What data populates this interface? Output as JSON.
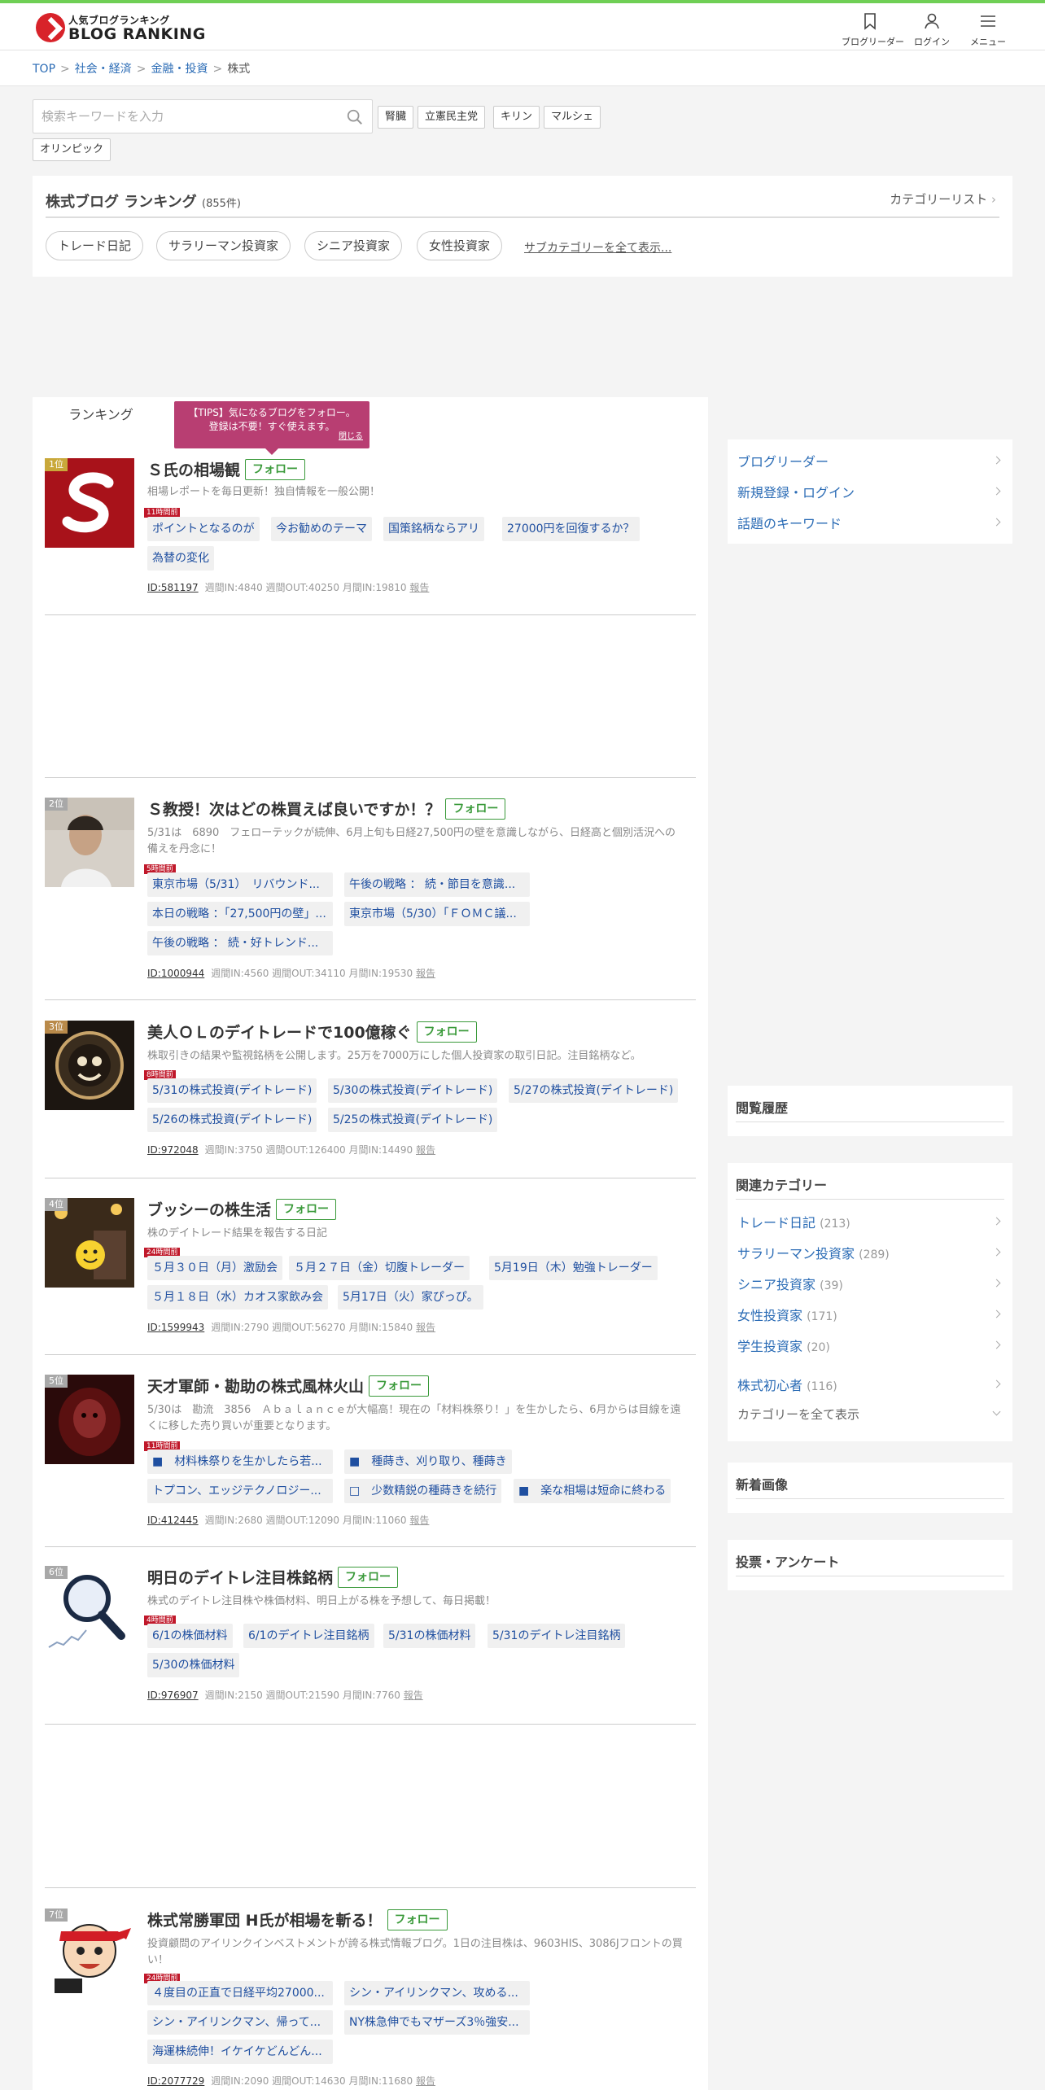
{
  "header": {
    "logo_small": "人気ブログランキング",
    "logo_big": "BLOG RANKING",
    "nav": [
      "ブログリーダー",
      "ログイン",
      "メニュー"
    ]
  },
  "breadcrumb": {
    "items": [
      "TOP",
      "社会・経済",
      "金融・投資"
    ],
    "current": "株式"
  },
  "search": {
    "placeholder": "検索キーワードを入力"
  },
  "keywords": [
    "腎臓",
    "立憲民主党",
    "キリン",
    "マルシェ",
    "オリンピック"
  ],
  "category": {
    "title": "株式ブログ ランキング",
    "count": "(855件)",
    "list_link": "カテゴリーリスト",
    "subcategories": [
      "トレード日記",
      "サラリーマン投資家",
      "シニア投資家",
      "女性投資家"
    ],
    "show_all": "サブカテゴリーを全て表示..."
  },
  "tab": {
    "label": "ランキング"
  },
  "tooltip": {
    "line1": "【TIPS】気になるブログをフォロー。",
    "line2": "登録は不要！すぐ使えます。",
    "close": "閉じる"
  },
  "follow_label": "フォロー",
  "report_label": "報告",
  "entries": [
    {
      "rank": "1位",
      "title": "Ｓ氏の相場観",
      "desc": "相場レポートを毎日更新！独自情報を一般公開！",
      "ago": "11時間前",
      "tags": [
        "ポイントとなるのが",
        "今お勧めのテーマ",
        "国策銘柄ならアリ",
        "27000円を回復するか？",
        "為替の変化"
      ],
      "id": "ID:581197",
      "stats": "週間IN:4840 週間OUT:40250 月間IN:19810"
    },
    {
      "rank": "2位",
      "title": "Ｓ教授！次はどの株買えば良いですか！？",
      "desc": "5/31は　6890　フェローテックが続伸、6月上旬も日経27,500円の壁を意識しながら、日経高と個別活況への備えを丹念に！",
      "ago": "5時間前",
      "tags": [
        "東京市場（5/31）　リバウンド...",
        "午後の戦略 ： 続・節目を意識...",
        "本日の戦略 ：「27,500円の壁」...",
        "東京市場（5/30）「ＦＯＭＣ議...",
        "午後の戦略 ： 続・好トレンド..."
      ],
      "id": "ID:1000944",
      "stats": "週間IN:4560 週間OUT:34110 月間IN:19530"
    },
    {
      "rank": "3位",
      "title": "美人ＯＬのデイトレードで100億稼ぐ",
      "desc": "株取引きの結果や監視銘柄を公開します。25万を7000万にした個人投資家の取引日記。注目銘柄など。",
      "ago": "8時間前",
      "tags": [
        "5/31の株式投資(デイトレード)",
        "5/30の株式投資(デイトレード)",
        "5/27の株式投資(デイトレード)",
        "5/26の株式投資(デイトレード)",
        "5/25の株式投資(デイトレード)"
      ],
      "id": "ID:972048",
      "stats": "週間IN:3750 週間OUT:126400 月間IN:14490"
    },
    {
      "rank": "4位",
      "title": "ブッシーの株生活",
      "desc": "株のデイトレード結果を報告する日記",
      "ago": "24時間前",
      "tags": [
        "５月３０日（月）激励会",
        "５月２７日（金）切腹トレーダー",
        "5月19日（木）勉強トレーダー",
        "５月１８日（水）カオス家飲み会",
        "5月17日（火）家ぴっぴ。"
      ],
      "id": "ID:1599943",
      "stats": "週間IN:2790 週間OUT:56270 月間IN:15840"
    },
    {
      "rank": "5位",
      "title": "天才軍師・勘助の株式風林火山",
      "desc": "5/30は　勘流　3856　Ａｂａｌａｎｃｅが大幅高！現在の「材料株祭り！」を生かしたら、6月からは目線を遠くに移した売り買いが重要となります。",
      "ago": "11時間前",
      "tags": [
        "■　材料株祭りを生かしたら若...",
        "■　種蒔き、刈り取り、種蒔き",
        "トプコン、エッジテクノロジー...",
        "□　少数精鋭の種蒔きを続行",
        "■　楽な相場は短命に終わる"
      ],
      "id": "ID:412445",
      "stats": "週間IN:2680 週間OUT:12090 月間IN:11060"
    },
    {
      "rank": "6位",
      "title": "明日のデイトレ注目株銘柄",
      "desc": "株式のデイトレ注目株や株価材料、明日上がる株を予想して、毎日掲載！",
      "ago": "4時間前",
      "tags": [
        "6/1の株価材料",
        "6/1のデイトレ注目銘柄",
        "5/31の株価材料",
        "5/31のデイトレ注目銘柄",
        "5/30の株価材料"
      ],
      "id": "ID:976907",
      "stats": "週間IN:2150 週間OUT:21590 月間IN:7760"
    },
    {
      "rank": "7位",
      "title": "株式常勝軍団 H氏が相場を斬る！",
      "desc": "投資顧問のアイリンクインベストメントが誇る株式情報ブログ。1日の注目株は、9603HIS、3086Jフロントの買い！",
      "ago": "24時間前",
      "tags": [
        "４度目の正直で日経平均27000...",
        "シン・アイリンクマン、攻める...",
        "シン・アイリンクマン、帰って...",
        "NY株急伸でもマザーズ3％強安...",
        "海運株続伸！イケイケどんどん..."
      ],
      "id": "ID:2077729",
      "stats": "週間IN:2090 週間OUT:14630 月間IN:11680"
    }
  ],
  "sidebar": {
    "links": [
      "ブログリーダー",
      "新規登録・ログイン",
      "話題のキーワード"
    ],
    "history_title": "閲覧履歴",
    "related_title": "関連カテゴリー",
    "related": [
      {
        "name": "トレード日記",
        "count": "(213)"
      },
      {
        "name": "サラリーマン投資家",
        "count": "(289)"
      },
      {
        "name": "シニア投資家",
        "count": "(39)"
      },
      {
        "name": "女性投資家",
        "count": "(171)"
      },
      {
        "name": "学生投資家",
        "count": "(20)"
      },
      {
        "name": "株式初心者",
        "count": "(116)"
      }
    ],
    "related_more": "カテゴリーを全て表示",
    "new_images_title": "新着画像",
    "vote_title": "投票・アンケート"
  }
}
